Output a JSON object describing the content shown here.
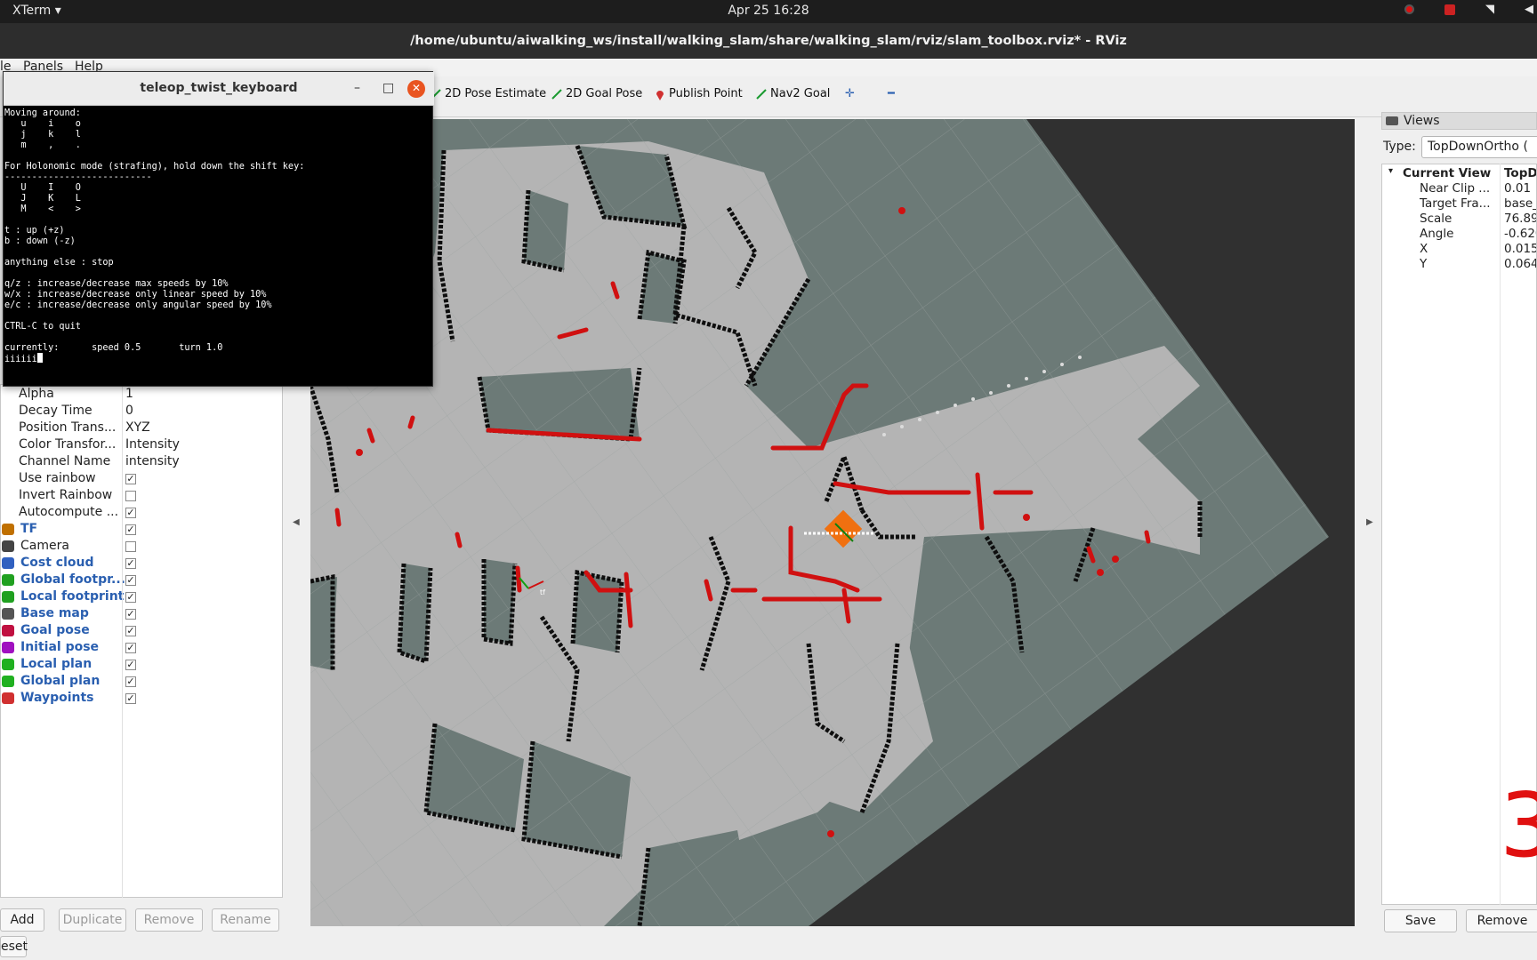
{
  "topbar": {
    "app_name": "XTerm ▾",
    "clock": "Apr 25  16:28"
  },
  "window": {
    "title": "/home/ubuntu/aiwalking_ws/install/walking_slam/share/walking_slam/rviz/slam_toolbox.rviz* - RViz"
  },
  "menu": {
    "file": "le",
    "panels": "Panels",
    "help": "Help"
  },
  "toolbar": {
    "pose_estimate": "2D Pose Estimate",
    "goal_pose": "2D Goal Pose",
    "publish_point": "Publish Point",
    "nav2_goal": "Nav2 Goal",
    "plus": "✛",
    "minus": "━"
  },
  "xterm": {
    "title": "teleop_twist_keyboard",
    "minimize": "–",
    "maximize": "□",
    "close": "✕",
    "lines": [
      "Moving around:",
      "   u    i    o",
      "   j    k    l",
      "   m    ,    .",
      "",
      "For Holonomic mode (strafing), hold down the shift key:",
      "---------------------------",
      "   U    I    O",
      "   J    K    L",
      "   M    <    >",
      "",
      "t : up (+z)",
      "b : down (-z)",
      "",
      "anything else : stop",
      "",
      "q/z : increase/decrease max speeds by 10%",
      "w/x : increase/decrease only linear speed by 10%",
      "e/c : increase/decrease only angular speed by 10%",
      "",
      "CTRL-C to quit",
      "",
      "currently:      speed 0.5       turn 1.0",
      "iiiiii"
    ]
  },
  "displays": {
    "properties": [
      {
        "key": "Alpha",
        "value": "1"
      },
      {
        "key": "Decay Time",
        "value": "0"
      },
      {
        "key": "Position Trans...",
        "value": "XYZ"
      },
      {
        "key": "Color Transfor...",
        "value": "Intensity"
      },
      {
        "key": "Channel Name",
        "value": "intensity"
      },
      {
        "key": "Use rainbow",
        "value": "✓"
      },
      {
        "key": "Invert Rainbow",
        "value": ""
      },
      {
        "key": "Autocompute ...",
        "value": "✓"
      }
    ],
    "items": [
      {
        "label": "TF",
        "checked": "✓",
        "icon": "tf-icon",
        "color": "#c07000"
      },
      {
        "label": "Camera",
        "checked": "",
        "icon": "camera-icon",
        "color": "#444444"
      },
      {
        "label": "Cost cloud",
        "checked": "✓",
        "icon": "point-cloud-icon",
        "color": "#3060c0"
      },
      {
        "label": "Global footpr...",
        "checked": "✓",
        "icon": "polygon-icon",
        "color": "#20a020"
      },
      {
        "label": "Local footprint",
        "checked": "✓",
        "icon": "polygon-icon",
        "color": "#20a020"
      },
      {
        "label": "Base map",
        "checked": "✓",
        "icon": "map-icon",
        "color": "#555555"
      },
      {
        "label": "Goal pose",
        "checked": "✓",
        "icon": "pose-icon",
        "color": "#c01040"
      },
      {
        "label": "Initial pose",
        "checked": "✓",
        "icon": "pose-icon",
        "color": "#a010c0"
      },
      {
        "label": "Local plan",
        "checked": "✓",
        "icon": "path-icon",
        "color": "#20b020"
      },
      {
        "label": "Global plan",
        "checked": "✓",
        "icon": "path-icon",
        "color": "#20b020"
      },
      {
        "label": "Waypoints",
        "checked": "✓",
        "icon": "marker-icon",
        "color": "#d03030"
      }
    ],
    "buttons": {
      "add": "Add",
      "duplicate": "Duplicate",
      "remove": "Remove",
      "rename": "Rename"
    },
    "reset": "eset"
  },
  "views": {
    "panel_title": "Views",
    "type_label": "Type:",
    "type_value": "TopDownOrtho (",
    "current_view_label": "Current View",
    "current_view_value": "TopD",
    "rows": [
      {
        "key": "Near Clip ...",
        "value": "0.01"
      },
      {
        "key": "Target Fra...",
        "value": "base_"
      },
      {
        "key": "Scale",
        "value": "76.89"
      },
      {
        "key": "Angle",
        "value": "-0.620"
      },
      {
        "key": "X",
        "value": "0.015"
      },
      {
        "key": "Y",
        "value": "0.064"
      }
    ],
    "save": "Save",
    "remove": "Remove",
    "overlay_number": "3"
  },
  "colors": {
    "free_space": "#b4b4b4",
    "unknown": "#6c7a77",
    "outside": "#303030",
    "wall": "#0e0e0e",
    "laser": "#d01010",
    "robot": "#f07010"
  }
}
